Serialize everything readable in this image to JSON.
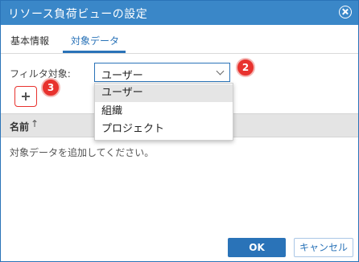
{
  "dialog": {
    "title": "リソース負荷ビューの設定"
  },
  "tabs": [
    {
      "label": "基本情報",
      "active": false
    },
    {
      "label": "対象データ",
      "active": true
    }
  ],
  "filter": {
    "label": "フィルタ対象:",
    "selected": "ユーザー",
    "options": [
      "ユーザー",
      "組織",
      "プロジェクト"
    ]
  },
  "badges": {
    "dropdown_marker": "2",
    "add_marker": "3"
  },
  "grid": {
    "column_name": "名前",
    "sort_glyph": "↑",
    "empty_message": "対象データを追加してください。"
  },
  "footer": {
    "ok_label": "OK",
    "cancel_label": "キャンセル"
  },
  "colors": {
    "accent": "#3a87c8",
    "primary_button": "#2a73b8",
    "marker": "#e8322e"
  }
}
